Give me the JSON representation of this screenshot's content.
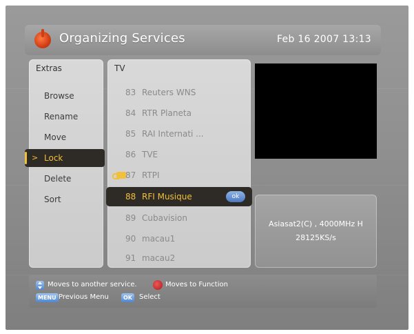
{
  "header": {
    "title": "Organizing Services",
    "datetime": "Feb 16 2007 13:13",
    "logo_icon": "power-plug-icon"
  },
  "extras": {
    "title": "Extras",
    "items": [
      {
        "label": "Browse"
      },
      {
        "label": "Rename"
      },
      {
        "label": "Move"
      },
      {
        "label": "Lock",
        "selected": true
      },
      {
        "label": "Delete"
      },
      {
        "label": "Sort"
      }
    ]
  },
  "tv": {
    "title": "TV",
    "channels": [
      {
        "num": "83",
        "name": "Reuters WNS"
      },
      {
        "num": "84",
        "name": "RTR Planeta"
      },
      {
        "num": "85",
        "name": "RAI Internati ..."
      },
      {
        "num": "86",
        "name": "TVE"
      },
      {
        "num": "87",
        "name": "RTPI",
        "locked": true
      },
      {
        "num": "88",
        "name": "RFI Musique",
        "selected": true
      },
      {
        "num": "89",
        "name": "Cubavision"
      },
      {
        "num": "90",
        "name": "macau1"
      },
      {
        "num": "91",
        "name": "macau2"
      }
    ],
    "ok_badge": "ok"
  },
  "info": {
    "line1": "Asiasat2(C) , 4000MHz H",
    "line2": "28125KS/s"
  },
  "help": {
    "move_service": "Moves to another service.",
    "move_function": "Moves to Function",
    "menu_key": "MENU",
    "previous_menu": "Previous Menu",
    "ok_key": "OK",
    "select": "Select"
  },
  "colors": {
    "accent": "#f1c13b",
    "selected_bg": "#2e2a25",
    "panel": "#d3d3d3",
    "preview": "#000000"
  }
}
